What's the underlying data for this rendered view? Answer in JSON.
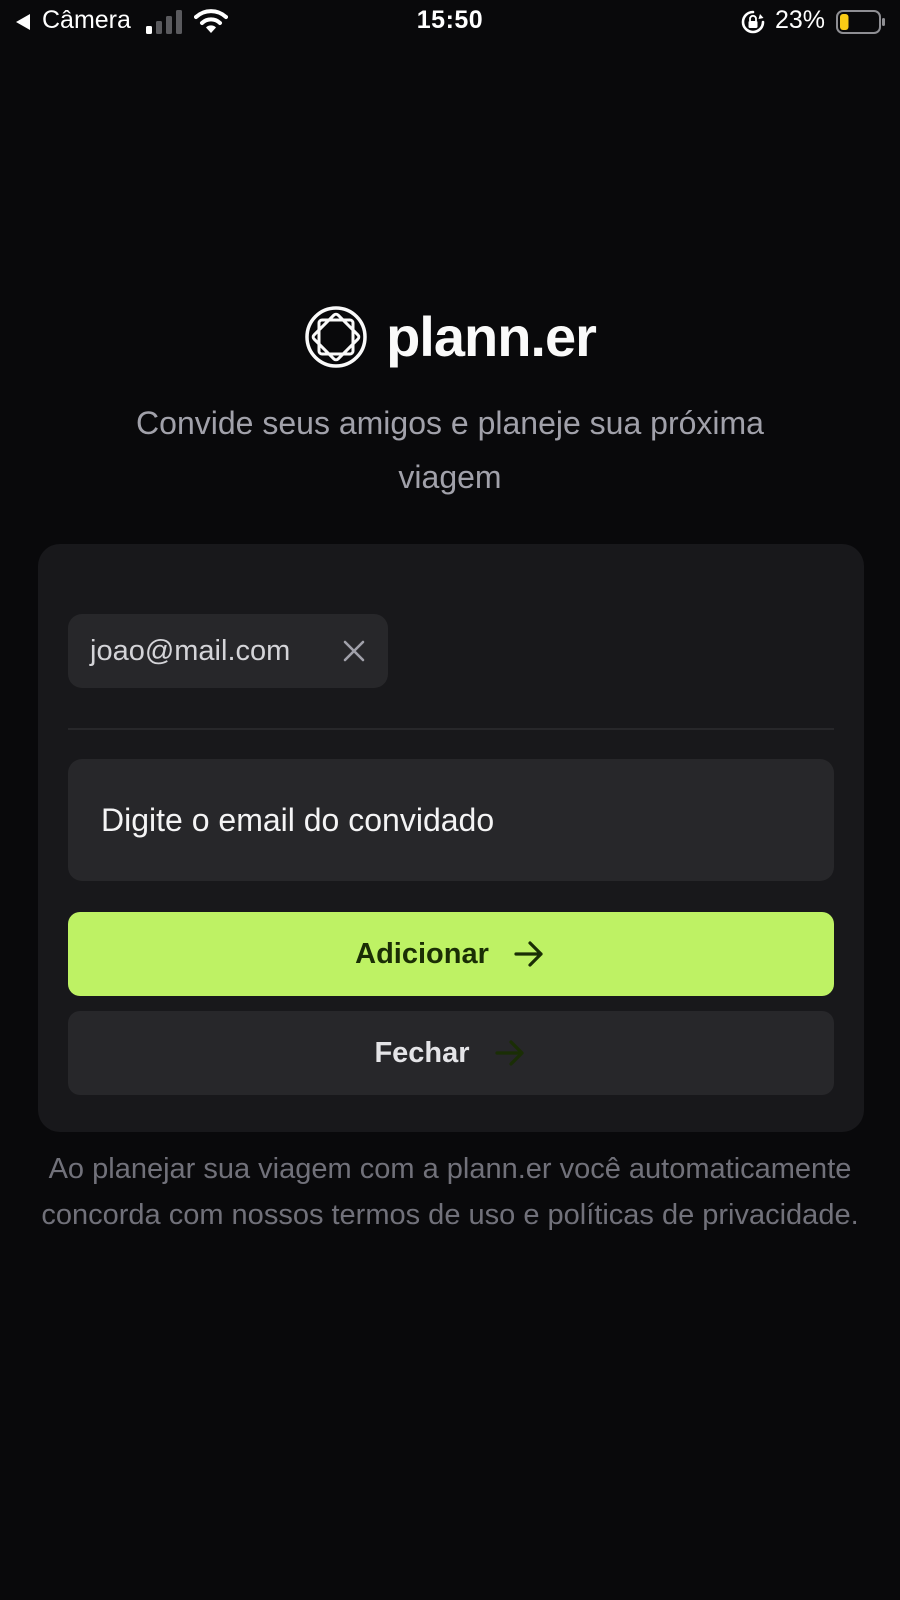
{
  "status_bar": {
    "back_app": "Câmera",
    "time": "15:50",
    "battery_percent": "23%",
    "battery_level": 0.23,
    "battery_color": "#facc15",
    "signal_bars_filled": 1,
    "signal_bars_total": 4
  },
  "header": {
    "logo_icon": "plann-er-logo-icon",
    "app_name": "plann.er",
    "tagline": "Convide seus amigos e planeje sua próxima viagem"
  },
  "card": {
    "guests": [
      {
        "email": "joao@mail.com",
        "remove_icon": "close-icon"
      }
    ],
    "email_input": {
      "placeholder": "Digite o email do convidado",
      "value": ""
    },
    "add_button": {
      "label": "Adicionar",
      "icon": "arrow-right-icon"
    },
    "close_button": {
      "label": "Fechar",
      "icon": "arrow-right-icon"
    }
  },
  "footer": {
    "terms_text": "Ao planejar sua viagem com a plann.er você automaticamente concorda com nossos termos de uso e políticas de privacidade."
  },
  "colors": {
    "background": "#09090b",
    "card": "#18181b",
    "input": "#27272a",
    "accent": "#bef264",
    "accent_text": "#1a2e05",
    "muted_text": "#a1a1aa"
  }
}
